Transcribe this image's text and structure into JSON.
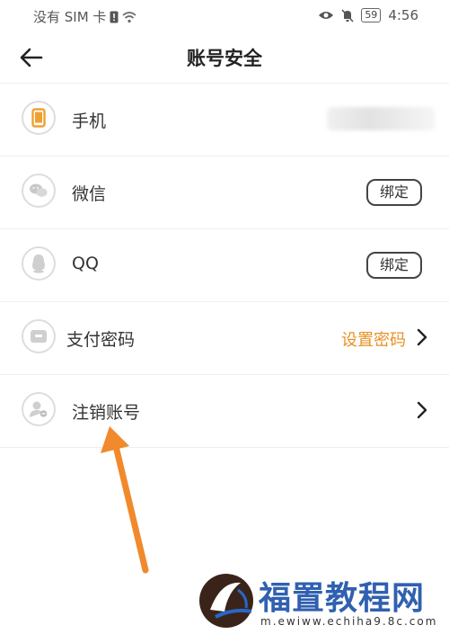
{
  "status_bar": {
    "carrier": "没有 SIM 卡",
    "battery": "59",
    "time": "4:56"
  },
  "header": {
    "title": "账号安全"
  },
  "rows": [
    {
      "label": "手机",
      "icon": "phone-icon"
    },
    {
      "label": "微信",
      "icon": "wechat-icon",
      "action": "绑定"
    },
    {
      "label": "QQ",
      "icon": "qq-icon",
      "action": "绑定"
    },
    {
      "label": "支付密码",
      "icon": "wallet-icon",
      "action": "设置密码"
    },
    {
      "label": "注销账号",
      "icon": "user-cancel-icon"
    }
  ],
  "watermark": {
    "title": "福置教程网",
    "url": "m.ewiww.echiha9.8c.com"
  },
  "colors": {
    "accent": "#e69225",
    "annotation_arrow": "#f08a2c",
    "phone_icon": "#f0a030",
    "watermark_blue": "#1a4fa8"
  }
}
